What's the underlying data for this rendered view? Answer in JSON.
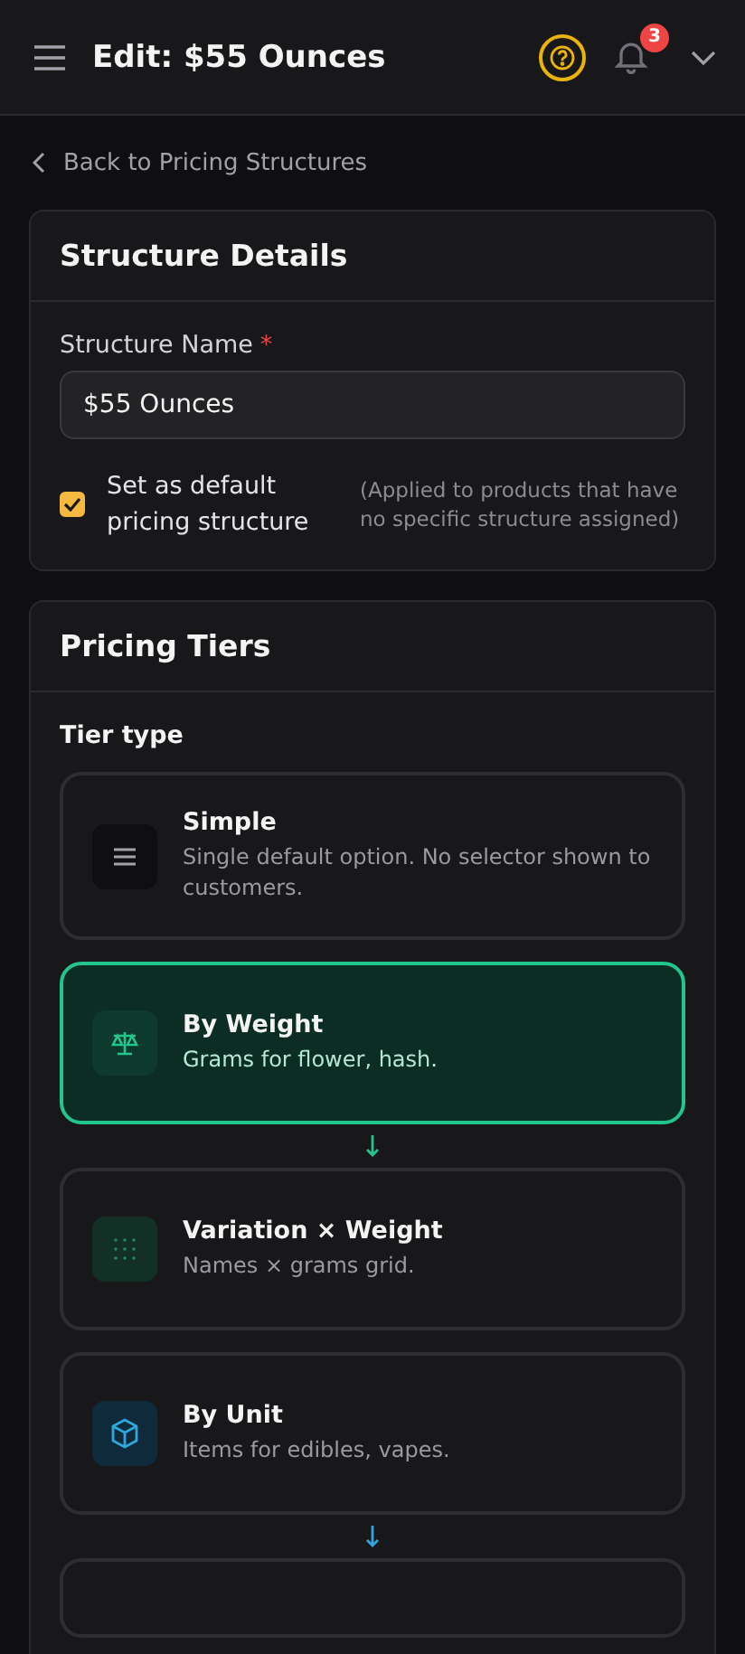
{
  "header": {
    "title": "Edit: $55 Ounces",
    "notification_count": "3"
  },
  "back_link": {
    "label": "Back to Pricing Structures"
  },
  "structure_details": {
    "title": "Structure Details",
    "name_label": "Structure Name",
    "required_mark": "*",
    "name_value": "$55 Ounces",
    "default_checkbox": {
      "label": "Set as default pricing structure",
      "checked": true,
      "hint": "(Applied to products that have no specific structure assigned)"
    }
  },
  "pricing_tiers": {
    "title": "Pricing Tiers",
    "tier_type_label": "Tier type",
    "options": [
      {
        "kind": "simple",
        "title": "Simple",
        "description": "Single default option. No selector shown to customers.",
        "selected": false,
        "arrow_below": false
      },
      {
        "kind": "weight",
        "title": "By Weight",
        "description": "Grams for flower, hash.",
        "selected": true,
        "arrow_below": true
      },
      {
        "kind": "grid",
        "title": "Variation × Weight",
        "description": "Names × grams grid.",
        "selected": false,
        "arrow_below": false
      },
      {
        "kind": "unit",
        "title": "By Unit",
        "description": "Items for edibles, vapes.",
        "selected": false,
        "arrow_below": true
      }
    ]
  }
}
